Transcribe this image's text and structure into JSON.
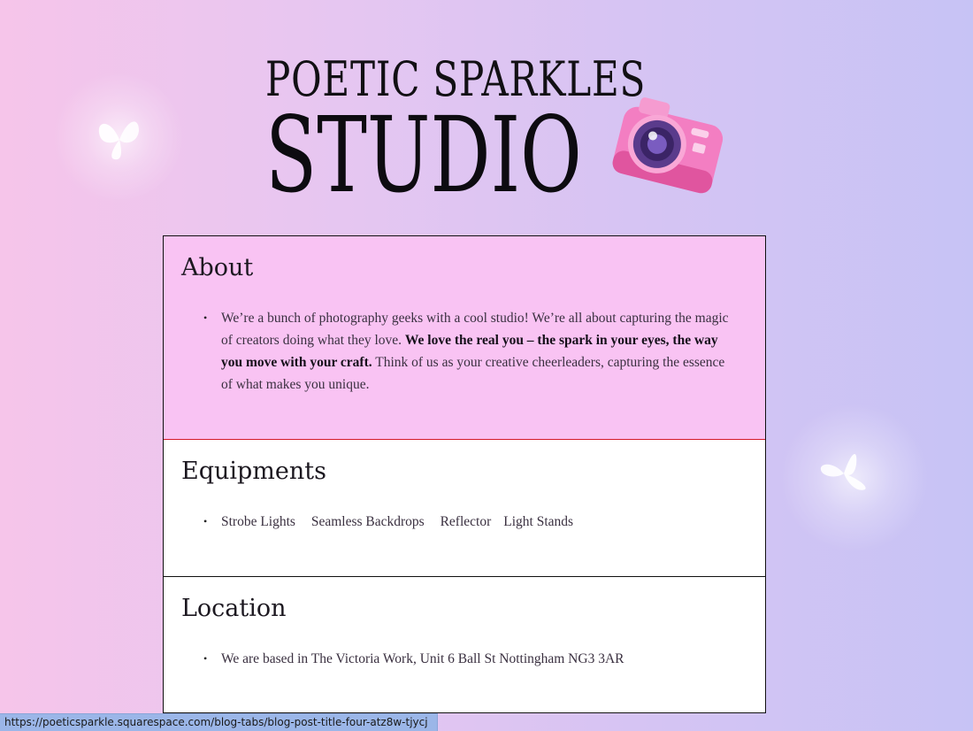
{
  "logo": {
    "line1": "POETIC SPARKLES",
    "line2": "STUDIO"
  },
  "sections": {
    "about": {
      "title": "About",
      "text_a": "We’re a bunch of photography geeks with a cool studio!  We’re all about capturing the magic of creators doing what they love. ",
      "text_bold": "We love the real you – the spark in your eyes, the way you move with your craft.",
      "text_b": " Think of us as your creative cheerleaders, capturing the essence of what makes you unique."
    },
    "equipments": {
      "title": "Equipments",
      "items": [
        "Strobe Lights",
        "Seamless Backdrops",
        "Reflector",
        "Light Stands"
      ]
    },
    "location": {
      "title": "Location",
      "text": "We are based in The Victoria Work, Unit 6 Ball St Nottingham NG3 3AR"
    }
  },
  "status_bar": {
    "url": "https://poeticsparkle.squarespace.com/blog-tabs/blog-post-title-four-atz8w-tjycj"
  },
  "colors": {
    "about_bg": "#f9c3f3",
    "about_divider": "#d4192a"
  }
}
